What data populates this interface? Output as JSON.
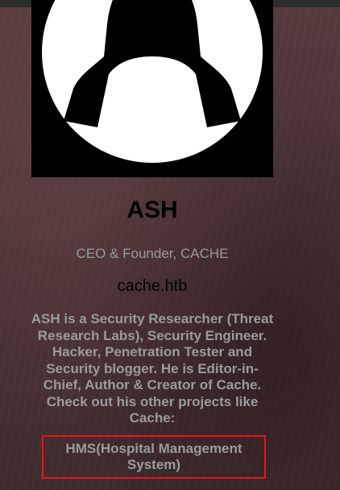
{
  "profile": {
    "name": "ASH",
    "role": "CEO & Founder, CACHE",
    "site": "cache.htb",
    "bio": "ASH is a Security Researcher (Threat Research Labs), Security Engineer. Hacker, Penetration Tester and Security blogger. He is Editor-in-Chief, Author & Creator of Cache. Check out his other projects like Cache:",
    "project": "HMS(Hospital Management System)"
  },
  "icons": {
    "avatar": "hooded-hacker-laptop-icon"
  },
  "colors": {
    "background": "#4a3234",
    "heading": "#000000",
    "muted_text": "#9b9b9b",
    "highlight_border": "#e8151b",
    "avatar_bg": "#000000",
    "avatar_fg": "#ffffff"
  }
}
